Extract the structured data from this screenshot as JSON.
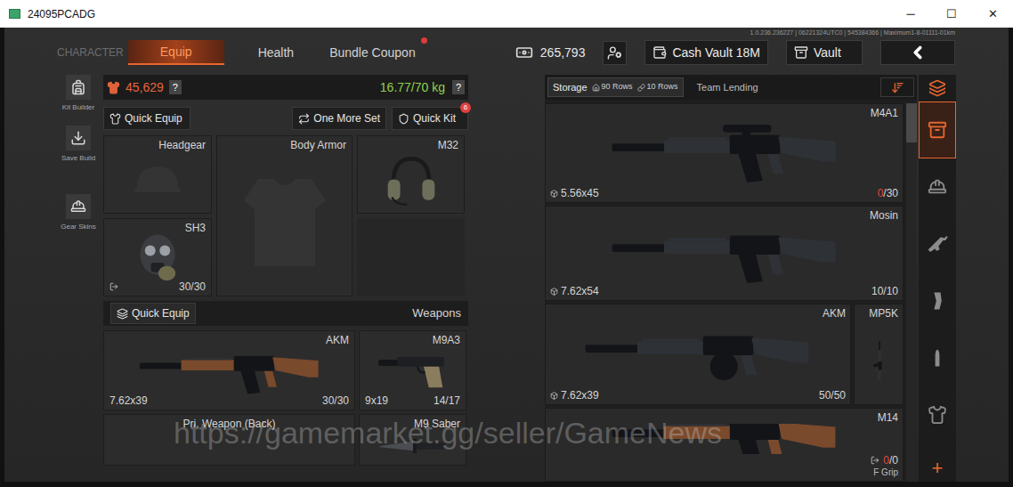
{
  "window": {
    "title": "24095PCADG",
    "controls": [
      "─",
      "☐",
      "✕"
    ]
  },
  "build_info": "1.0.236.236227 | 06221324UTC0 | 545384366 | Maximum1-8-01111-01km",
  "nav": {
    "tabs": [
      {
        "label": "CHARACTER",
        "selected": false,
        "dot": false,
        "dimmed": true
      },
      {
        "label": "Equip",
        "selected": true,
        "dot": false,
        "dimmed": false
      },
      {
        "label": "Health",
        "selected": false,
        "dot": false,
        "dimmed": false
      },
      {
        "label": "Bundle Coupon",
        "selected": false,
        "dot": true,
        "dimmed": false
      }
    ],
    "currency": "265,793",
    "buttons": [
      {
        "label": "Cash Vault 18M"
      },
      {
        "label": "Vault"
      }
    ]
  },
  "sidebar": {
    "items": [
      {
        "label": "Kit Builder"
      },
      {
        "label": "Save Build"
      },
      {
        "label": "Gear Skins"
      }
    ]
  },
  "loadout": {
    "value": "45,629",
    "weight": "16.77/70 kg",
    "help": "?",
    "buttons": [
      {
        "label": "Quick Equip",
        "badge": null
      },
      {
        "label": "One More Set",
        "badge": null
      },
      {
        "label": "Quick Kit",
        "badge": "6"
      }
    ],
    "gear_slots": [
      {
        "label": "Headgear",
        "kind": "helmet",
        "empty": true
      },
      {
        "label": "Body Armor",
        "kind": "armor",
        "empty": true
      },
      {
        "label": "M32",
        "kind": "headset",
        "empty": false
      },
      {
        "label": "SH3",
        "kind": "mask",
        "empty": false,
        "ammo": "30/30",
        "linked": true
      },
      {
        "label": null,
        "kind": "spare",
        "empty": true
      }
    ],
    "weapons_header": {
      "button": "Quick Equip",
      "label": "Weapons"
    },
    "weapon_slots": [
      {
        "label": "AKM",
        "kind": "rifle",
        "caliber": "7.62x39",
        "ammo": "30/30",
        "empty": false
      },
      {
        "label": "M9A3",
        "kind": "pistol",
        "caliber": "9x19",
        "ammo": "14/17",
        "empty": false
      },
      {
        "label": "Pri. Weapon (Back)",
        "kind": "slot",
        "empty": true
      },
      {
        "label": "M9 Saber",
        "kind": "knife",
        "empty": false
      }
    ]
  },
  "storage": {
    "tabs": [
      {
        "label": "Storage",
        "selected": true,
        "counts": [
          "90 Rows",
          "10 Rows"
        ]
      },
      {
        "label": "Team Lending",
        "selected": false,
        "counts": []
      }
    ],
    "rows": [
      {
        "items": [
          {
            "name": "M4A1",
            "caliber": "5.56x45",
            "ammo_current": "0",
            "ammo_rest": "/30",
            "ammo_empty": true,
            "linked": false,
            "attachment": null
          }
        ]
      },
      {
        "items": [
          {
            "name": "Mosin",
            "caliber": "7.62x54",
            "ammo_current": "10",
            "ammo_rest": "/10",
            "ammo_empty": false,
            "linked": false,
            "attachment": null
          }
        ]
      },
      {
        "items": [
          {
            "name": "AKM",
            "caliber": "7.62x39",
            "ammo_current": "50",
            "ammo_rest": "/50",
            "ammo_empty": false,
            "linked": false,
            "attachment": null
          },
          {
            "name": "MP5K",
            "caliber": null,
            "ammo_current": null,
            "ammo_rest": null,
            "ammo_empty": false,
            "linked": false,
            "attachment": null
          }
        ]
      },
      {
        "items": [
          {
            "name": "M14",
            "caliber": null,
            "ammo_current": "0",
            "ammo_rest": "/0",
            "ammo_empty": true,
            "linked": true,
            "attachment": "F Grip"
          }
        ]
      }
    ],
    "categories": [
      {
        "selected": false
      },
      {
        "selected": true
      },
      {
        "selected": false
      },
      {
        "selected": false
      },
      {
        "selected": false
      },
      {
        "selected": false
      },
      {
        "selected": false
      }
    ],
    "add": "+"
  },
  "watermark": "https://gamemarket.gg/seller/GameNews"
}
